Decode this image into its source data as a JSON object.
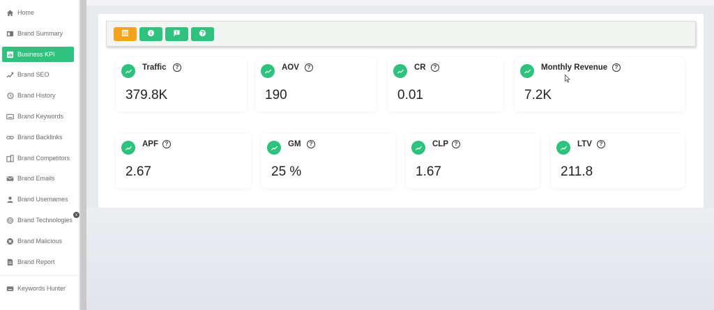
{
  "sidebar": {
    "items": [
      {
        "label": "Home",
        "icon": "home-icon"
      },
      {
        "label": "Brand Summary",
        "icon": "summary-icon"
      },
      {
        "label": "Business KPI",
        "icon": "chart-icon",
        "active": true
      },
      {
        "label": "Brand SEO",
        "icon": "seo-icon"
      },
      {
        "label": "Brand History",
        "icon": "history-icon"
      },
      {
        "label": "Brand Keywords",
        "icon": "keyboard-icon"
      },
      {
        "label": "Brand Backlinks",
        "icon": "link-icon"
      },
      {
        "label": "Brand Competitors",
        "icon": "competitors-icon"
      },
      {
        "label": "Brand Emails",
        "icon": "mail-icon"
      },
      {
        "label": "Brand Usernames",
        "icon": "user-icon"
      },
      {
        "label": "Brand Technologies",
        "icon": "fingerprint-icon"
      },
      {
        "label": "Brand Malicious",
        "icon": "close-circle-icon"
      },
      {
        "label": "Brand Report",
        "icon": "report-icon"
      },
      {
        "label": "Keywords Hunter",
        "icon": "keyboard-icon"
      }
    ],
    "badge": "x"
  },
  "toolbar": {
    "buttons": [
      {
        "icon": "grid-icon",
        "color": "#f5a31a"
      },
      {
        "icon": "info-icon",
        "color": "#2ec27e"
      },
      {
        "icon": "flag-icon",
        "color": "#2ec27e"
      },
      {
        "icon": "help-icon",
        "color": "#2ec27e"
      }
    ]
  },
  "kpis": {
    "row1": [
      {
        "label": "Traffic",
        "value": "379.8K"
      },
      {
        "label": "AOV",
        "value": "190"
      },
      {
        "label": "CR",
        "value": "0.01"
      },
      {
        "label": "Monthly Revenue",
        "value": "7.2K"
      }
    ],
    "row2": [
      {
        "label": "APF",
        "value": "2.67"
      },
      {
        "label": "GM",
        "value": "25 %"
      },
      {
        "label": "CLP",
        "value": "1.67"
      },
      {
        "label": "LTV",
        "value": "211.8"
      }
    ],
    "help_glyph": "?"
  },
  "colors": {
    "accent": "#2ec27e",
    "orange": "#f5a31a"
  }
}
